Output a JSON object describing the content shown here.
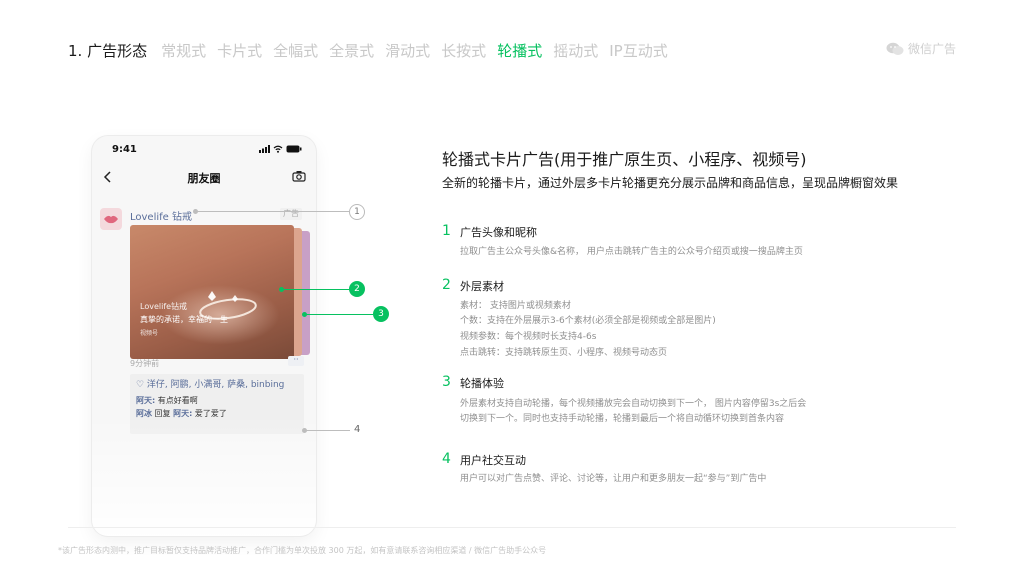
{
  "nav": {
    "section_title": "1. 广告形态",
    "tabs": [
      {
        "label": "常规式",
        "active": false
      },
      {
        "label": "卡片式",
        "active": false
      },
      {
        "label": "全幅式",
        "active": false
      },
      {
        "label": "全景式",
        "active": false
      },
      {
        "label": "滑动式",
        "active": false
      },
      {
        "label": "长按式",
        "active": false
      },
      {
        "label": "轮播式",
        "active": true
      },
      {
        "label": "摇动式",
        "active": false
      },
      {
        "label": "IP互动式",
        "active": false
      }
    ],
    "brand": "微信广告",
    "accent_color": "#07c160"
  },
  "phone": {
    "time": "9:41",
    "header_title": "朋友圈",
    "nickname": "Lovelife 钻戒",
    "ad_tag": "广告",
    "card": {
      "brand": "Lovelife钻戒",
      "slogan": "真挚的承诺，幸福的一生",
      "channel": "视频号"
    },
    "time_ago": "9分钟前",
    "more": "··",
    "likes": "♡ 洋仔, 阿鹏, 小满哥, 萨桑, binbing",
    "comments": [
      {
        "who": "阿天:",
        "text": " 有点好看啊"
      },
      {
        "who": "阿冰",
        "text": " 回复 ",
        "who2": "阿天:",
        "text2": " 爱了爱了"
      }
    ]
  },
  "callouts": [
    "1",
    "2",
    "3",
    "4"
  ],
  "main": {
    "title": "轮播式卡片广告(用于推广原生页、小程序、视频号)",
    "subtitle": "全新的轮播卡片，通过外层多卡片轮播更充分展示品牌和商品信息，呈现品牌橱窗效果",
    "features": [
      {
        "num": "1",
        "title": "广告头像和昵称",
        "lines": [
          "拉取广告主公众号头像&名称，  用户点击跳转广告主的公众号介绍页或搜一搜品牌主页"
        ]
      },
      {
        "num": "2",
        "title": "外层素材",
        "lines": [
          "素材：  支持图片或视频素材",
          "个数：支持在外层展示3-6个素材(必须全部是视频或全部是图片)",
          "视频参数：每个视频时长支持4-6s",
          "点击跳转：支持跳转原生页、小程序、视频号动态页"
        ]
      },
      {
        "num": "3",
        "title": "轮播体验",
        "lines": [
          "外层素材支持自动轮播，每个视频播放完会自动切换到下一个，   图片内容停留3s之后会",
          "切换到下一个。同时也支持手动轮播，轮播到最后一个将自动循环切换到首条内容"
        ]
      },
      {
        "num": "4",
        "title": "用户社交互动",
        "lines": [
          "用户可以对广告点赞、评论、讨论等，让用户和更多朋友一起“参与”到广告中"
        ]
      }
    ]
  },
  "footnote": "*该广告形态内测中，推广目标暂仅支持品牌活动推广，合作门槛为单次投放 300 万起，如有意请联系咨询相应渠道 / 微信广告助手公众号"
}
